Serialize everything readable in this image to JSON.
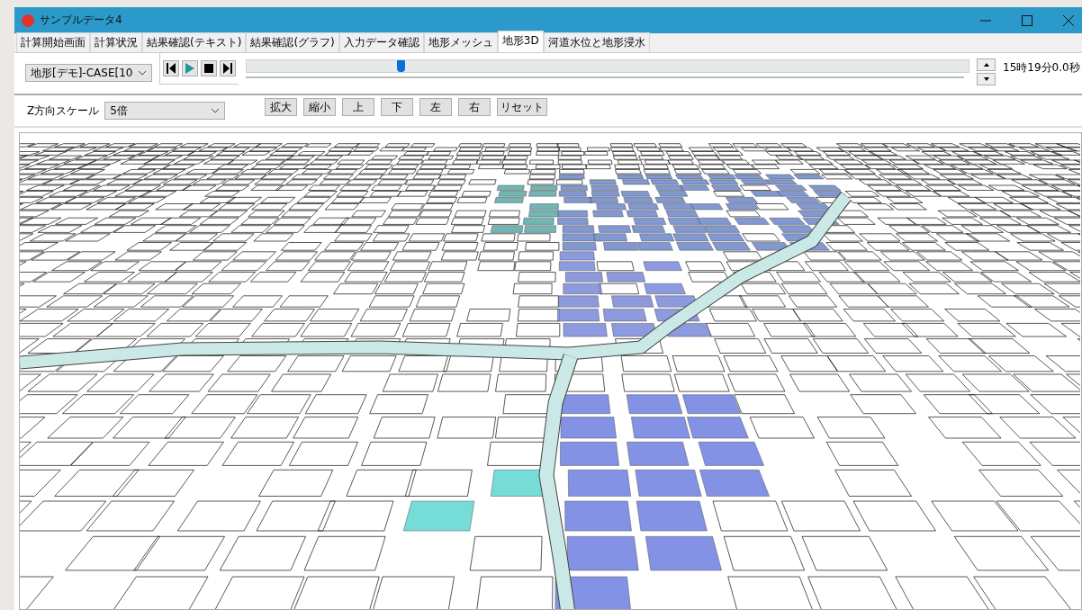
{
  "window": {
    "title": "サンプルデータ4"
  },
  "tabs": [
    {
      "label": "計算開始画面",
      "selected": false
    },
    {
      "label": "計算状況",
      "selected": false
    },
    {
      "label": "結果確認(テキスト)",
      "selected": false
    },
    {
      "label": "結果確認(グラフ)",
      "selected": false
    },
    {
      "label": "入力データ確認",
      "selected": false
    },
    {
      "label": "地形メッシュ",
      "selected": false
    },
    {
      "label": "地形3D",
      "selected": true
    },
    {
      "label": "河道水位と地形浸水",
      "selected": false
    }
  ],
  "playback": {
    "case_select": "地形[デモ]-CASE[10",
    "time_slider": {
      "level": 0.214
    },
    "time": "15時19分0.0秒"
  },
  "view_controls": {
    "z_scale_label": "Z方向スケール",
    "z_scale_select": "5倍",
    "buttons": [
      "拡大",
      "縮小",
      "上",
      "下",
      "左",
      "右",
      "リセット"
    ]
  }
}
